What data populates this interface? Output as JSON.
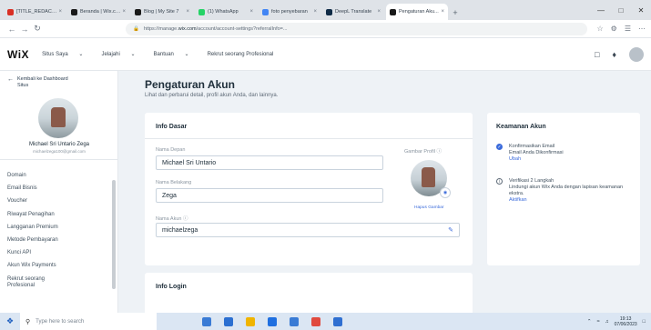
{
  "browser": {
    "tabs": [
      {
        "title": "[TITLE_REDACTED] ...",
        "color": "#d93025",
        "active": false
      },
      {
        "title": "Beranda | Wix.com",
        "color": "#1a1a1a",
        "active": false
      },
      {
        "title": "Blog | My Site 7",
        "color": "#1a1a1a",
        "active": false
      },
      {
        "title": "(1) WhatsApp",
        "color": "#25d366",
        "active": false
      },
      {
        "title": "foto penyebaran",
        "color": "#4285f4",
        "active": false
      },
      {
        "title": "DeepL Translate",
        "color": "#0f2b46",
        "active": false
      },
      {
        "title": "Pengaturan Aku...",
        "color": "#1a1a1a",
        "active": true
      }
    ],
    "new_tab": "+",
    "url_prefix": "https://manage.",
    "url_domain": "wix.com",
    "url_rest": "/account/account-settings?referralInfo=..."
  },
  "wix_header": {
    "logo": "WiX",
    "site_menu": "Situs Saya",
    "menu": [
      "Jelajahi",
      "Bantuan",
      "Rekrut seorang Profesional"
    ]
  },
  "sidebar": {
    "back_label": "Kembali ke Dashboard Situs",
    "user_name": "Michael Sri Untario Zega",
    "user_email": "michaelzega100@gmail.com",
    "items": [
      {
        "label": "Domain"
      },
      {
        "label": "Email Bisnis"
      },
      {
        "label": "Voucher"
      },
      {
        "label": "Riwayat Penagihan"
      },
      {
        "label": "Langganan Premium"
      },
      {
        "label": "Metode Pembayaran"
      },
      {
        "label": "Kunci API"
      },
      {
        "label": "Akun Wix Payments"
      },
      {
        "label": "Rekrut seorang Profesional"
      }
    ]
  },
  "main": {
    "title": "Pengaturan Akun",
    "subtitle": "Lihat dan perbarui detail, profil akun Anda, dan lainnya.",
    "basic_info": {
      "title": "Info Dasar",
      "first_name_label": "Nama Depan",
      "first_name_value": "Michael Sri Untario",
      "last_name_label": "Nama Belakang",
      "last_name_value": "Zega",
      "account_name_label": "Nama Akun ⓘ",
      "account_name_value": "michaelzega",
      "photo_label": "Gambar Profil ⓘ",
      "photo_link": "Hapus Gambar"
    },
    "login_info": {
      "title": "Info Login"
    },
    "security": {
      "title": "Keamanan Akun",
      "item1_title": "Konfirmasikan Email",
      "item1_desc": "Email Anda Dikonfirmasi",
      "item1_link": "Ubah",
      "item2_title": "Verifikasi 2 Langkah",
      "item2_desc": "Lindungi akun Wix Anda dengan lapisan keamanan ekstra.",
      "item2_link": "Aktifkan"
    }
  },
  "taskbar": {
    "search_placeholder": "Type here to search",
    "time": "19:13",
    "date": "07/06/2023",
    "app_colors": [
      "#3a7bd5",
      "#2b6fd1",
      "#f0b400",
      "#1f6fe0",
      "#3a7bd5",
      "#e04a3f",
      "#2f6fd1"
    ]
  }
}
